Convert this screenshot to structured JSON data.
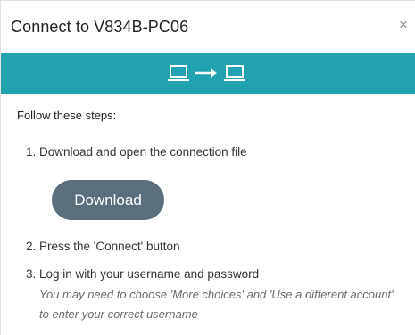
{
  "dialog": {
    "title": "Connect to V834B-PC06",
    "close_label": "×"
  },
  "banner": {
    "icons": [
      "computer-icon",
      "arrow-right-icon",
      "computer-icon"
    ],
    "color": "#22a1b0"
  },
  "instructions": {
    "heading": "Follow these steps:",
    "step1": "1. Download and open the connection file",
    "download_button": "Download",
    "step2": "2. Press the 'Connect' button",
    "step3": "3. Log in with your username and password",
    "step3_note": "You may need to choose 'More choices' and 'Use a different account' to enter your correct username"
  }
}
